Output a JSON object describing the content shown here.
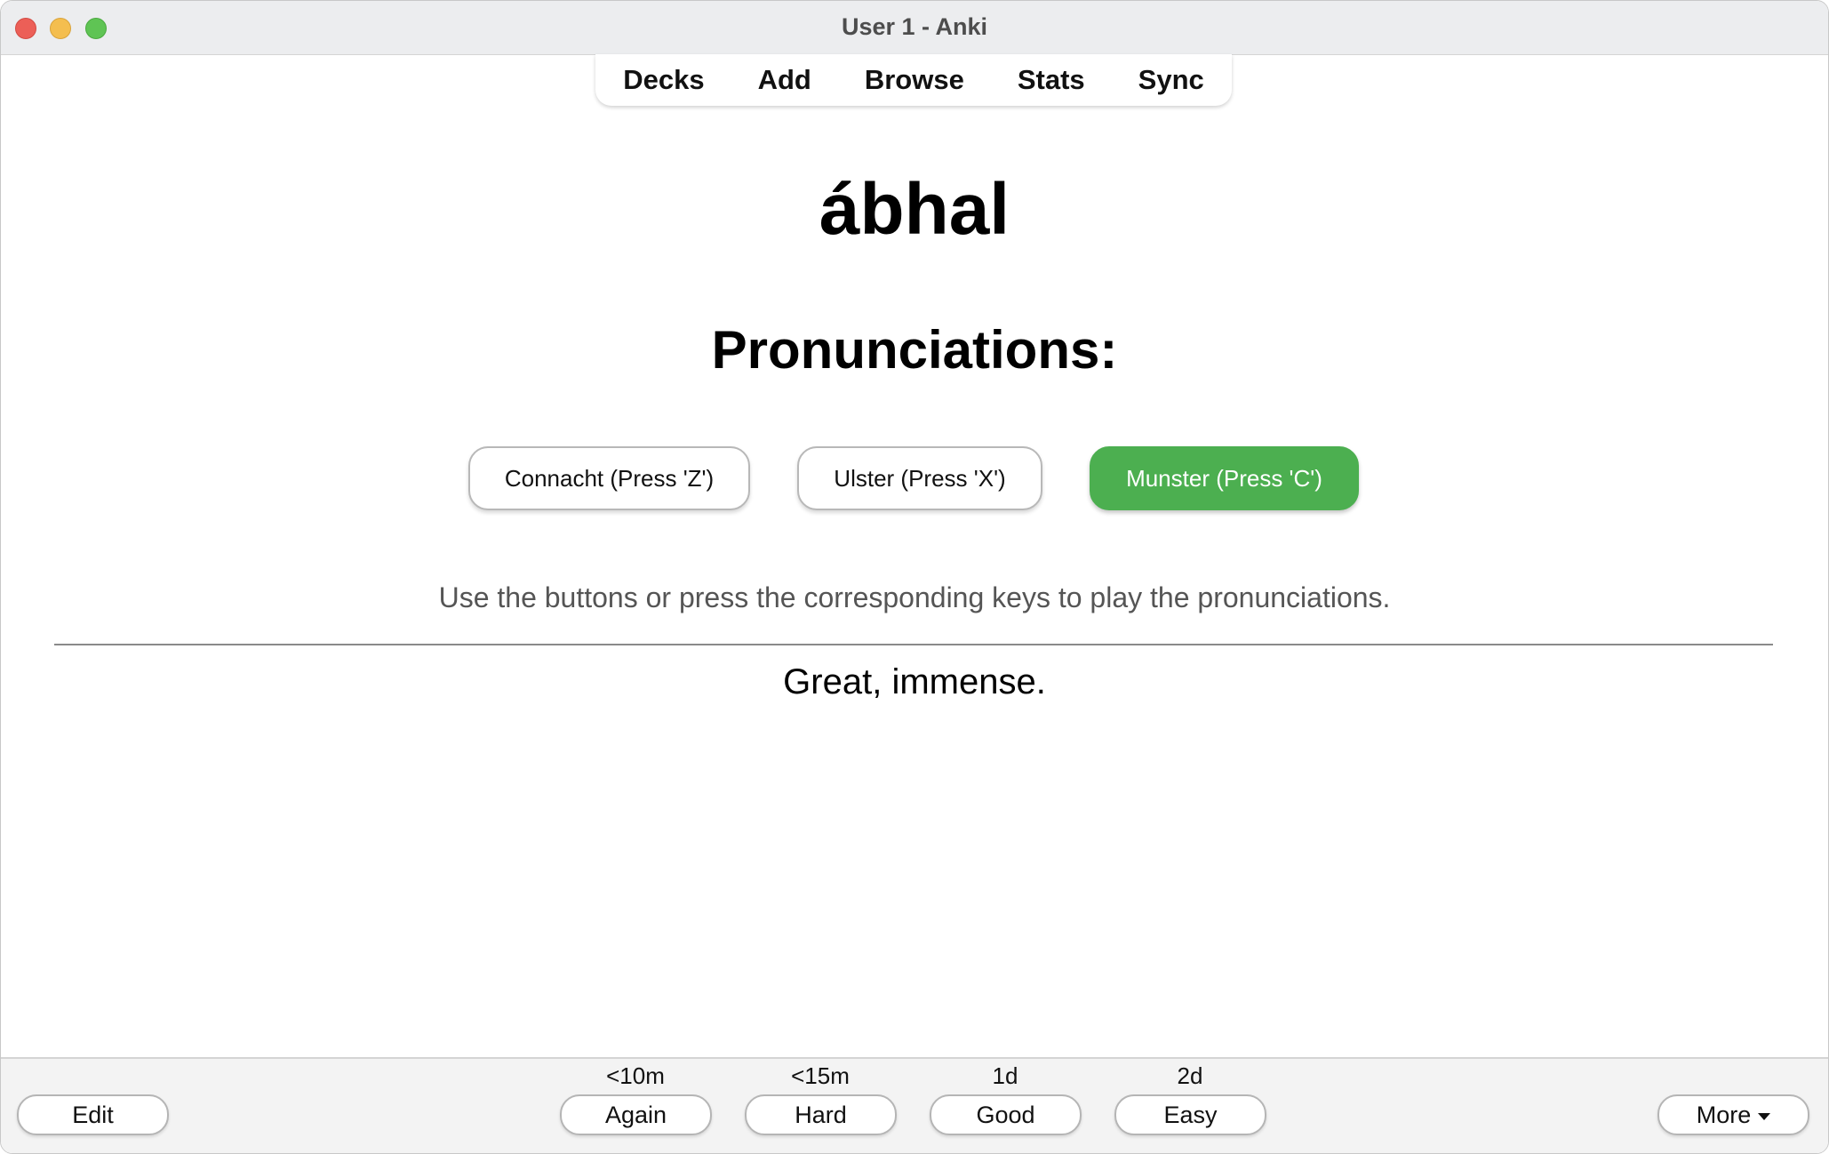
{
  "window": {
    "title": "User 1 - Anki"
  },
  "nav": {
    "items": [
      "Decks",
      "Add",
      "Browse",
      "Stats",
      "Sync"
    ]
  },
  "card": {
    "word": "ábhal",
    "pronunciations_heading": "Pronunciations:",
    "pronunciation_buttons": [
      {
        "label": "Connacht (Press 'Z')",
        "active": false
      },
      {
        "label": "Ulster (Press 'X')",
        "active": false
      },
      {
        "label": "Munster (Press 'C')",
        "active": true
      }
    ],
    "instructions": "Use the buttons or press the corresponding keys to play the pronunciations.",
    "answer": "Great, immense."
  },
  "bottom": {
    "edit_label": "Edit",
    "more_label": "More",
    "answers": [
      {
        "label": "Again",
        "interval": "<10m"
      },
      {
        "label": "Hard",
        "interval": "<15m"
      },
      {
        "label": "Good",
        "interval": "1d"
      },
      {
        "label": "Easy",
        "interval": "2d"
      }
    ]
  },
  "colors": {
    "accent_green": "#4caf50",
    "titlebar_bg": "#ecedef",
    "close": "#ec5f57",
    "minimize": "#f4be4f",
    "maximize": "#5fc454"
  }
}
